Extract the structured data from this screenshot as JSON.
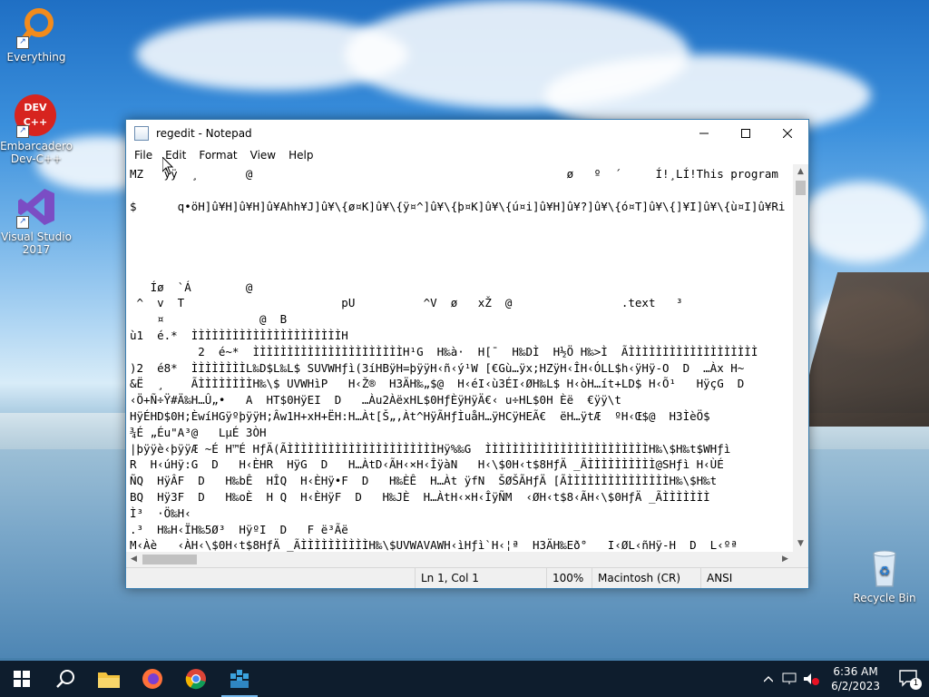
{
  "desktop": {
    "icons": [
      {
        "label": "Everything"
      },
      {
        "label": "Embarcadero Dev-C++"
      },
      {
        "label": "Visual Studio 2017"
      },
      {
        "label": "Recycle Bin"
      }
    ],
    "devcpp_badge": "DEV C++"
  },
  "notepad": {
    "title": "regedit - Notepad",
    "menu": [
      "File",
      "Edit",
      "Format",
      "View",
      "Help"
    ],
    "content_lines": [
      "MZ   ÿÿ  ¸       @                                              ø   º  ´     Í!¸LÍ!This program",
      "",
      "$      q•öH]û¥H]û¥H]û¥Ahh¥J]û¥\\{ø¤K]û¥\\{ÿ¤^]û¥\\{þ¤K]û¥\\{ú¤i]û¥H]û¥?]û¥\\{ó¤T]û¥\\{]¥I]û¥\\{ù¤I]û¥Ri",
      "",
      "",
      "",
      "",
      "   Íø  `Á        @        ",
      " ^  v  T                       pU          ^V  ø   xŽ  @                .text   ³",
      "    ¤              @  B",
      "ù1  é.*  ÌÌÌÌÌÌÌÌÌÌÌÌÌÌÌÌÌÌÌÌÌÌH",
      "          2  é~*  ÌÌÌÌÌÌÌÌÌÌÌÌÌÌÌÌÌÌÌÌÌÌH¹G  H‰à·  H[¯  H‰DÌ  H½Ö H‰>Ì  ÃÌÌÌÌÌÌÌÌÌÌÌÌÌÌÌÌÌÌÌ",
      ")2  é8*  ÌÌÌÌÌÌÌÌL‰D$L‰L$ SUVWHƒì(3íHBÿH=þÿÿH‹ñ‹ý¹W [€Gù…ÿx;HZÿH‹ÎH‹ÓLL$h‹ÿHÿ-O  D  …Àx H~",
      "&Ë  ¸    ÃÌÌÌÌÌÌÌÌH‰\\$ UVWHìP   H‹Ž®  H3ÄH‰„$@  H‹éI‹ù3ÉI‹ØH‰L$ H‹òH…ít+LD$ H‹Õ¹   HÿçG  D",
      "‹Ö+Ñ÷Ÿ#Ä‰H…Û„•   A  HT$0HÿEI  D   …Àu2ÀëxHL$0HƒÈÿHÿÄ€‹ u÷HL$0H Èë  €ÿÿ\\t",
      "HÿÉHD$0H;ÈwíHGÿºþÿÿH;Âw1H+xH+ËH:H…Àt[Š„,Àt^HÿÃHƒÌuåH…ÿHCÿHEÃ€  ëH…ÿtÆ  ºH‹Œ$@  H3ÌèÖ$",
      "¾É „Éu\"A³@   LµÉ 3ÒH",
      "|þÿÿè‹þÿÿÆ ~É H™É HƒÄ(ÃÌÌÌÌÌÌÌÌÌÌÌÌÌÌÌÌÌÌÌÌÌÌHÿ%‰G  ÌÌÌÌÌÌÌÌÌÌÌÌÌÌÌÌÌÌÌÌÌÌÌÌH‰\\$H‰t$WHƒì",
      "R  H‹úHÿ:G  D   H‹ÈHR  HÿG  D   H…ÀtD‹ÃH‹×H‹ÎÿàN   H‹\\$0H‹t$8HƒÄ _ÃÌÌÌÌÌÌÌÌÌÌ@SHƒì H‹ÙÉ",
      "ÑQ  HÿÂF  D   H‰bÊ  HÎQ  H‹ÈHÿ•F  D   H‰ÈÊ  H…Àt ÿfN  ŠØŠÃHƒÄ [ÃÌÌÌÌÌÌÌÌÌÌÌÌÌÌÌH‰\\$H‰t",
      "BQ  Hÿ3F  D   H‰oÈ  H Q  H‹ÈHÿF  D   H‰JÈ  H…ÀtH‹×H‹ÎÿÑM  ‹ØH‹t$8‹ÃH‹\\$0HƒÄ _ÃÌÌÌÌÌÌÌ",
      "Ì³  ·Ö‰H‹",
      ".³  H‰H‹ÏH‰5Ø³  HÿºI  D   F ë³Ãë",
      "M‹Àè   ‹ÀH‹\\$0H‹t$8HƒÄ _ÃÌÌÌÌÌÌÌÌÌÌH‰\\$UVWAVAWH‹ìHƒì`H‹¦ª  H3ÄH‰Eð°   I‹ØL‹ñHÿ-H  D  L‹ºª",
      "     +  HÿÏ#A   D  éG   I‹Òèd   ‹Àé;    I‹Ã¥Ù.ÒHÁé Ò·Àè   é   é    HT$0HÿGÆG  D   H‹L$0HT$"
    ],
    "status": {
      "position": "Ln 1, Col 1",
      "zoom": "100%",
      "line_ending": "Macintosh (CR)",
      "encoding": "ANSI"
    }
  },
  "taskbar": {
    "apps": [
      "start",
      "search",
      "file-explorer",
      "firefox",
      "chrome",
      "regedit"
    ],
    "time": "6:36 AM",
    "date": "6/2/2023",
    "notification_count": "1"
  }
}
